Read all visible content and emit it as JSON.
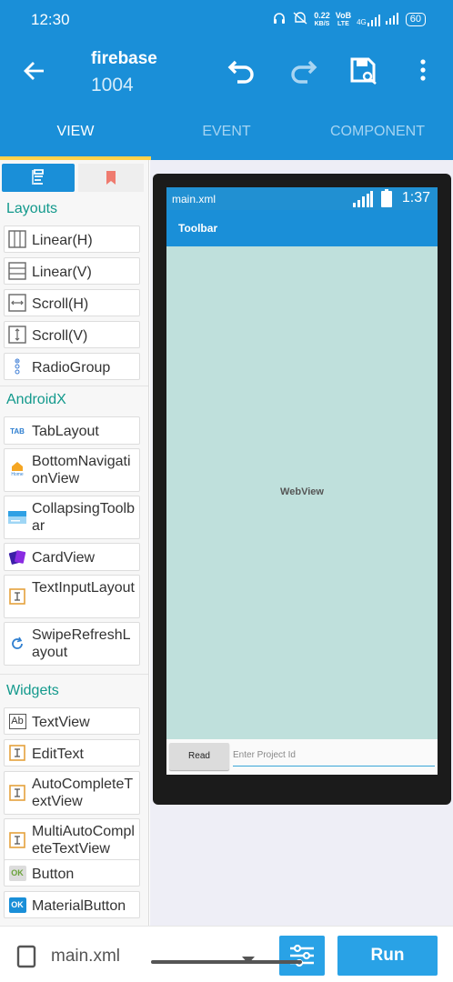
{
  "status_bar": {
    "time": "12:30",
    "speed_value": "0.22",
    "speed_unit": "KB/S",
    "volte_top": "VoB",
    "volte_bottom": "LTE",
    "network": "4G",
    "battery": "60"
  },
  "app_bar": {
    "title": "firebase",
    "subtitle": "1004",
    "icons": [
      "back-arrow-icon",
      "undo-icon",
      "redo-icon",
      "save-icon",
      "more-vert-icon"
    ]
  },
  "tabs": [
    {
      "label": "VIEW",
      "active": true
    },
    {
      "label": "EVENT",
      "active": false
    },
    {
      "label": "COMPONENT",
      "active": false
    }
  ],
  "palette": {
    "sections": [
      {
        "title": "Layouts",
        "items": [
          {
            "label": "Linear(H)",
            "icon": "linear-h-icon"
          },
          {
            "label": "Linear(V)",
            "icon": "linear-v-icon"
          },
          {
            "label": "Scroll(H)",
            "icon": "scroll-h-icon"
          },
          {
            "label": "Scroll(V)",
            "icon": "scroll-v-icon"
          },
          {
            "label": "RadioGroup",
            "icon": "radiogroup-icon"
          }
        ]
      },
      {
        "title": "AndroidX",
        "items": [
          {
            "label": "TabLayout",
            "icon": "tablayout-icon"
          },
          {
            "label": "BottomNavigationView",
            "icon": "bottom-navigation-icon"
          },
          {
            "label": "CollapsingToolbar",
            "icon": "collapsing-toolbar-icon"
          },
          {
            "label": "CardView",
            "icon": "cardview-icon"
          },
          {
            "label": "TextInputLayout",
            "icon": "textinputlayout-icon"
          },
          {
            "label": "SwipeRefreshLayout",
            "icon": "swiperefresh-icon"
          }
        ]
      },
      {
        "title": "Widgets",
        "items": [
          {
            "label": "TextView",
            "icon": "textview-icon"
          },
          {
            "label": "EditText",
            "icon": "edittext-icon"
          },
          {
            "label": "AutoCompleteTextView",
            "icon": "autocomplete-icon"
          },
          {
            "label": "MultiAutoCompleteTextView",
            "icon": "multiautocomplete-icon"
          },
          {
            "label": "Button",
            "icon": "button-icon"
          },
          {
            "label": "MaterialButton",
            "icon": "materialbutton-icon"
          }
        ]
      }
    ],
    "icon_text": {
      "tab": "TAB",
      "home": "Home",
      "textview": "Ab",
      "button": "OK",
      "materialbutton": "OK"
    }
  },
  "preview": {
    "file_name": "main.xml",
    "time": "1:37",
    "toolbar_title": "Toolbar",
    "webview_label": "WebView",
    "read_button": "Read",
    "input_hint": "Enter Project Id"
  },
  "bottom_bar": {
    "file_name": "main.xml",
    "run_label": "Run"
  },
  "colors": {
    "primary": "#1a8fd8",
    "accent": "#ffd24a",
    "section_title": "#12998c",
    "webview_bg": "#bfe0dc",
    "button_blue": "#29a2e6"
  }
}
